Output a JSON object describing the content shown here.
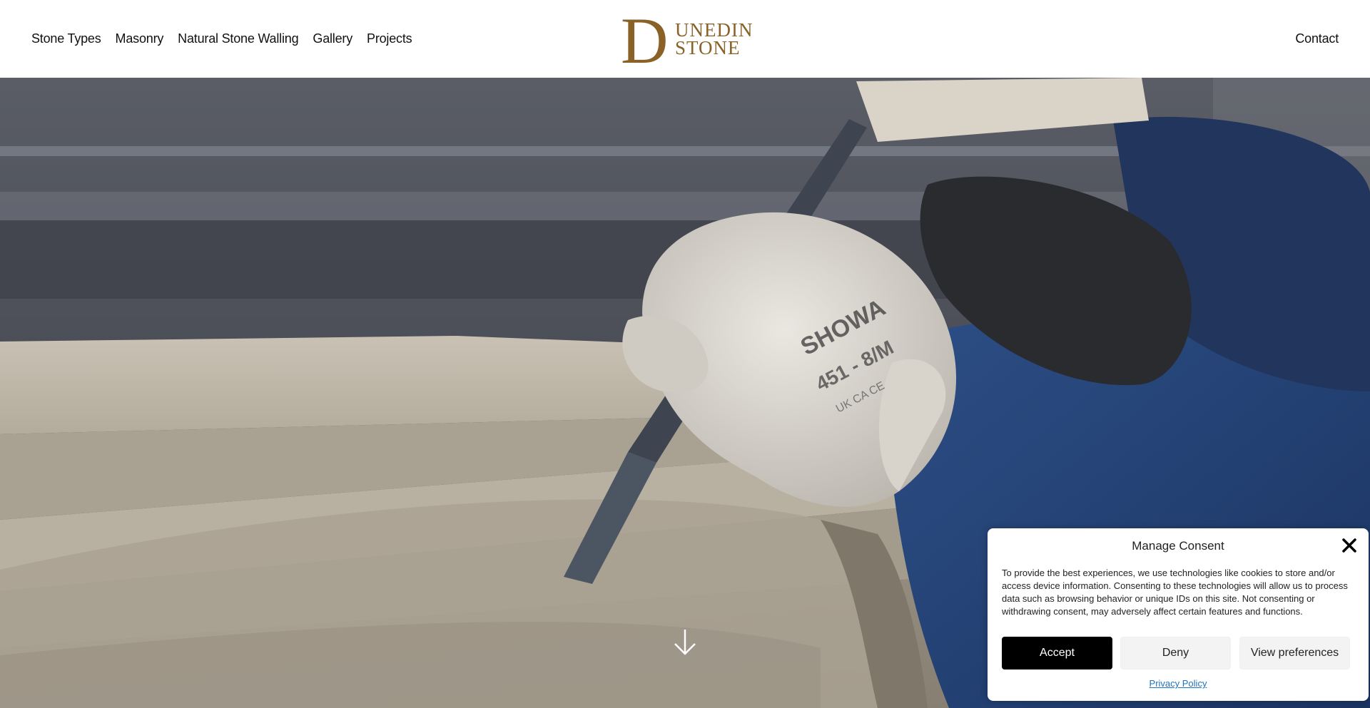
{
  "nav": {
    "items": [
      {
        "label": "Stone Types"
      },
      {
        "label": "Masonry"
      },
      {
        "label": "Natural Stone Walling"
      },
      {
        "label": "Gallery"
      },
      {
        "label": "Projects"
      }
    ],
    "contact_label": "Contact"
  },
  "logo": {
    "line1": "UNEDIN",
    "line2": "STONE",
    "initial": "D",
    "color": "#8a6228"
  },
  "hero": {
    "scroll_icon": "arrow-down-icon",
    "glove_print": {
      "brand": "SHOWA",
      "model": "451 - 8/M",
      "marks": "UK CA CE"
    }
  },
  "consent": {
    "title": "Manage Consent",
    "text": "To provide the best experiences, we use technologies like cookies to store and/or access device information. Consenting to these technologies will allow us to process data such as browsing behavior or unique IDs on this site. Not consenting or withdrawing consent, may adversely affect certain features and functions.",
    "accept_label": "Accept",
    "deny_label": "Deny",
    "preferences_label": "View preferences",
    "privacy_label": "Privacy Policy",
    "close_icon": "close-icon"
  }
}
